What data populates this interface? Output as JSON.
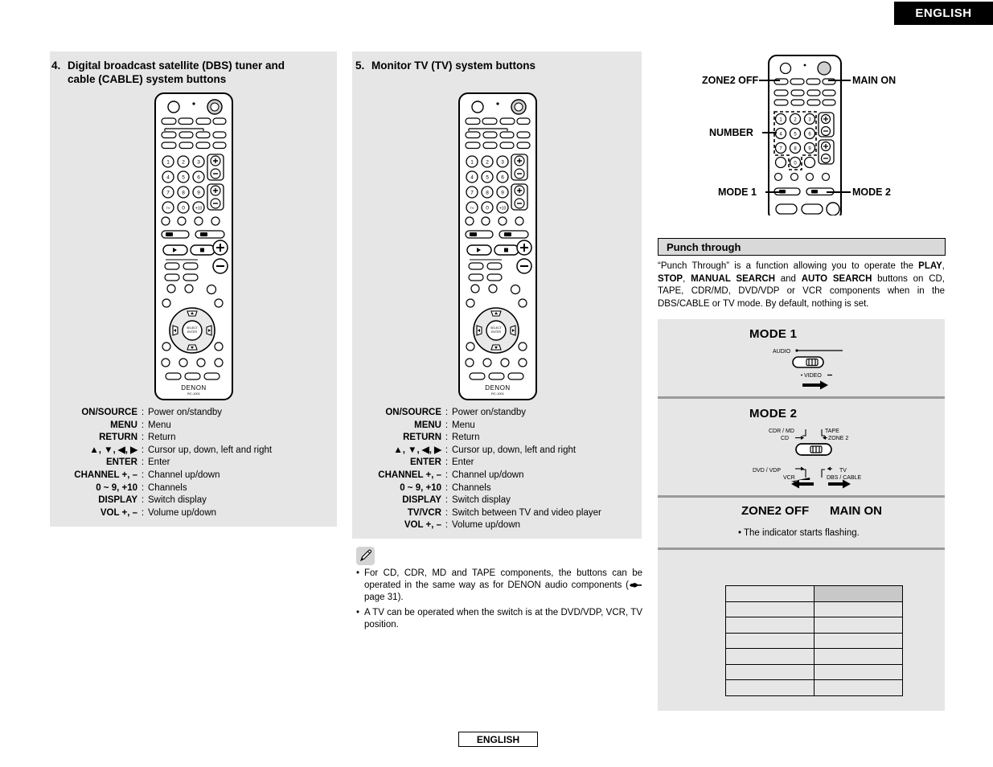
{
  "header": {
    "language_badge": "ENGLISH"
  },
  "footer": {
    "language_badge": "ENGLISH"
  },
  "sections": {
    "dbs": {
      "number": "4.",
      "title": "Digital broadcast satellite (DBS) tuner and cable (CABLE) system buttons",
      "title_line1": "Digital broadcast satellite (DBS) tuner and",
      "title_line2": "cable (CABLE) system buttons",
      "buttons": [
        {
          "term": "ON/SOURCE",
          "desc": "Power on/standby"
        },
        {
          "term": "MENU",
          "desc": "Menu"
        },
        {
          "term": "RETURN",
          "desc": "Return"
        },
        {
          "term": "▲, ▼, ◀, ▶",
          "desc": "Cursor up, down, left and right"
        },
        {
          "term": "ENTER",
          "desc": "Enter"
        },
        {
          "term": "CHANNEL +, –",
          "desc": "Channel up/down"
        },
        {
          "term": "0 ~ 9, +10",
          "desc": "Channels"
        },
        {
          "term": "DISPLAY",
          "desc": "Switch display"
        },
        {
          "term": "VOL +, –",
          "desc": "Volume up/down"
        }
      ]
    },
    "tv": {
      "number": "5.",
      "title": "Monitor TV (TV) system buttons",
      "buttons": [
        {
          "term": "ON/SOURCE",
          "desc": "Power on/standby"
        },
        {
          "term": "MENU",
          "desc": "Menu"
        },
        {
          "term": "RETURN",
          "desc": "Return"
        },
        {
          "term": "▲, ▼, ◀, ▶",
          "desc": "Cursor up, down, left and right"
        },
        {
          "term": "ENTER",
          "desc": "Enter"
        },
        {
          "term": "CHANNEL +, –",
          "desc": "Channel up/down"
        },
        {
          "term": "0 ~ 9, +10",
          "desc": "Channels"
        },
        {
          "term": "DISPLAY",
          "desc": "Switch display"
        },
        {
          "term": "TV/VCR",
          "desc": "Switch between TV and video player"
        },
        {
          "term": "VOL +, –",
          "desc": "Volume up/down"
        }
      ]
    }
  },
  "note": {
    "icon": "pencil-icon",
    "items": [
      "For CD, CDR, MD and TAPE components, the buttons can be operated in the same way as for DENON audio components (",
      "A TV can be operated when the switch is at the DVD/VDP, VCR, TV position."
    ],
    "page_ref": "page 31)."
  },
  "punch_through": {
    "title": "Punch through",
    "paragraph_parts": [
      "“Punch Through” is a function allowing you to operate the ",
      "PLAY",
      ", ",
      "STOP",
      ", ",
      "MANUAL SEARCH",
      " and ",
      "AUTO SEARCH",
      " buttons on CD, TAPE, CDR/MD, DVD/VDP or VCR components when in the DBS/CABLE or TV mode. By default, nothing is set."
    ]
  },
  "modes": {
    "mode1": {
      "label": "MODE 1",
      "switch_top_label": "AUDIO",
      "switch_bottom_label": "VIDEO"
    },
    "mode2": {
      "label": "MODE 2",
      "top_labels": [
        "CDR / MD",
        "CD",
        "TAPE",
        "ZONE 2"
      ],
      "bottom_labels": [
        "DVD / VDP",
        "VCR",
        "TV",
        "DBS / CABLE"
      ]
    },
    "zone_row": {
      "zone2_off": "ZONE2 OFF",
      "main_on": "MAIN ON",
      "note": "• The indicator starts flashing."
    }
  },
  "blank_table": {
    "rows": 7,
    "cols": 2,
    "shaded_cell": "row0-col1"
  },
  "callouts": {
    "zone2_off": "ZONE2 OFF",
    "main_on": "MAIN ON",
    "number": "NUMBER",
    "mode1": "MODE 1",
    "mode2": "MODE 2"
  },
  "remote": {
    "brand": "DENON",
    "model": "RC-1001",
    "keypad": [
      "1",
      "2",
      "3",
      "4",
      "5",
      "6",
      "7",
      "8",
      "9",
      "TV/VCR",
      "0",
      "+10"
    ],
    "center_button": "SELECT/ENTER",
    "rockers": [
      "VOLUME",
      "CHANNEL"
    ]
  },
  "colors": {
    "panel_bg": "#e6e6e6",
    "header_bg": "#000000",
    "header_fg": "#ffffff",
    "divider": "#9a9a9a",
    "title_box_bg": "#d9d9d9",
    "table_shade": "#c8c8c8"
  }
}
